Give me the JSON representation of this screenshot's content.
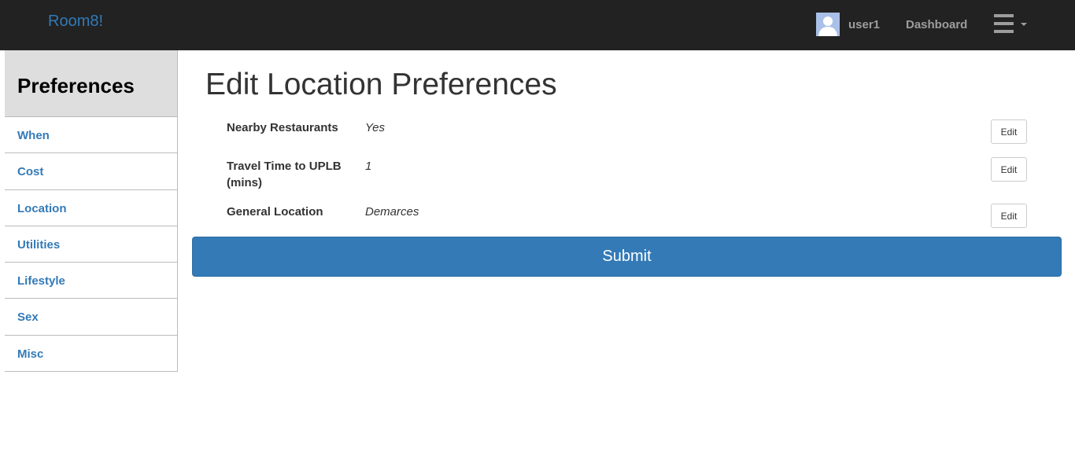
{
  "navbar": {
    "brand": "Room8!",
    "username": "user1",
    "dashboard_label": "Dashboard",
    "menu_icon": "hamburger-icon"
  },
  "sidebar": {
    "title": "Preferences",
    "items": [
      {
        "label": "When"
      },
      {
        "label": "Cost"
      },
      {
        "label": "Location"
      },
      {
        "label": "Utilities"
      },
      {
        "label": "Lifestyle"
      },
      {
        "label": "Sex"
      },
      {
        "label": "Misc"
      }
    ]
  },
  "main": {
    "title": "Edit Location Preferences",
    "preferences": [
      {
        "label": "Nearby Restaurants",
        "value": "Yes",
        "edit_label": "Edit"
      },
      {
        "label": "Travel Time to UPLB (mins)",
        "value": "1",
        "edit_label": "Edit"
      },
      {
        "label": "General Location",
        "value": "Demarces",
        "edit_label": "Edit"
      }
    ],
    "submit_label": "Submit"
  },
  "colors": {
    "navbar_bg": "#222222",
    "link": "#337ab7",
    "primary": "#337ab7",
    "sidebar_header_bg": "#dedede"
  }
}
